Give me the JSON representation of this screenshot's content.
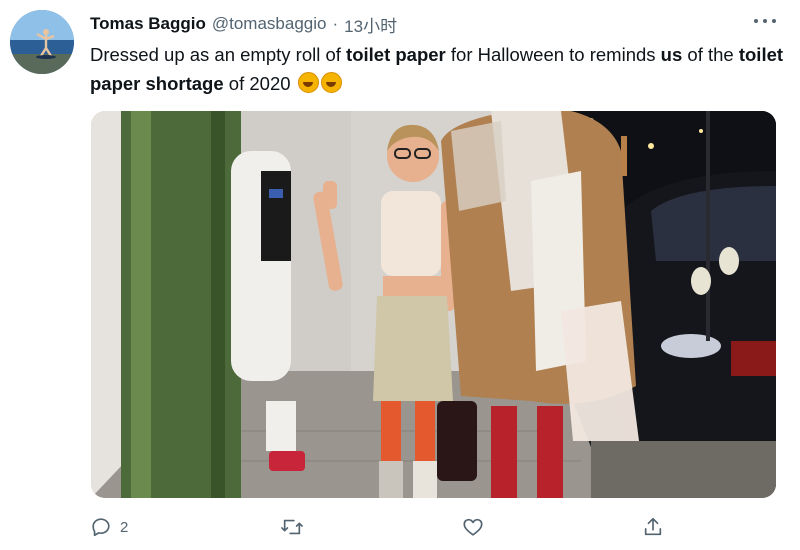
{
  "tweet": {
    "author_name": "Tomas Baggio",
    "handle": "@tomasbaggio",
    "separator": "·",
    "time": "13小时",
    "text_parts": [
      "Dressed up as an empty roll of ",
      "toilet paper",
      " for Halloween to reminds ",
      "us",
      " of the ",
      "toilet paper shortage",
      " of 2020 "
    ],
    "emoji": [
      "rolling-on-the-floor-laughing-emoji",
      "rolling-on-the-floor-laughing-emoji"
    ]
  },
  "actions": {
    "reply_icon": "reply-icon",
    "reply_count": "2",
    "retweet_icon": "retweet-icon",
    "like_icon": "heart-icon",
    "share_icon": "share-icon"
  },
  "colors": {
    "text": "#0f1419",
    "secondary": "#536471",
    "accent": "#1d9bf0"
  }
}
